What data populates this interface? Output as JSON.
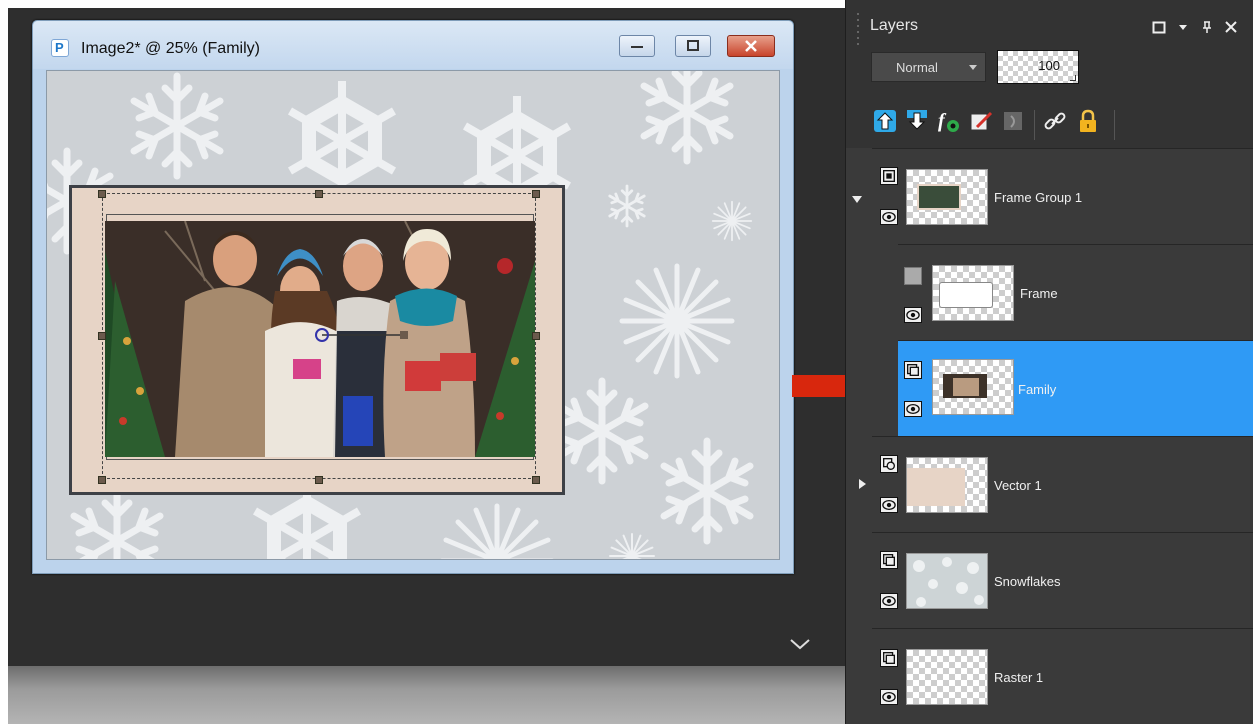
{
  "document": {
    "title": "Image2* @  25% (Family)"
  },
  "layers_panel": {
    "title": "Layers",
    "blend_mode": "Normal",
    "opacity": "100",
    "layers": [
      {
        "name": "Frame Group 1",
        "expanded": true
      },
      {
        "name": "Frame"
      },
      {
        "name": "Family",
        "selected": true
      },
      {
        "name": "Vector 1",
        "expanded": false
      },
      {
        "name": "Snowflakes"
      },
      {
        "name": "Raster 1"
      }
    ]
  },
  "colors": {
    "selection": "#2f9af5",
    "frame": "#e7d4c6",
    "canvas": "#cdd1d5",
    "arrow": "#d8270d"
  }
}
